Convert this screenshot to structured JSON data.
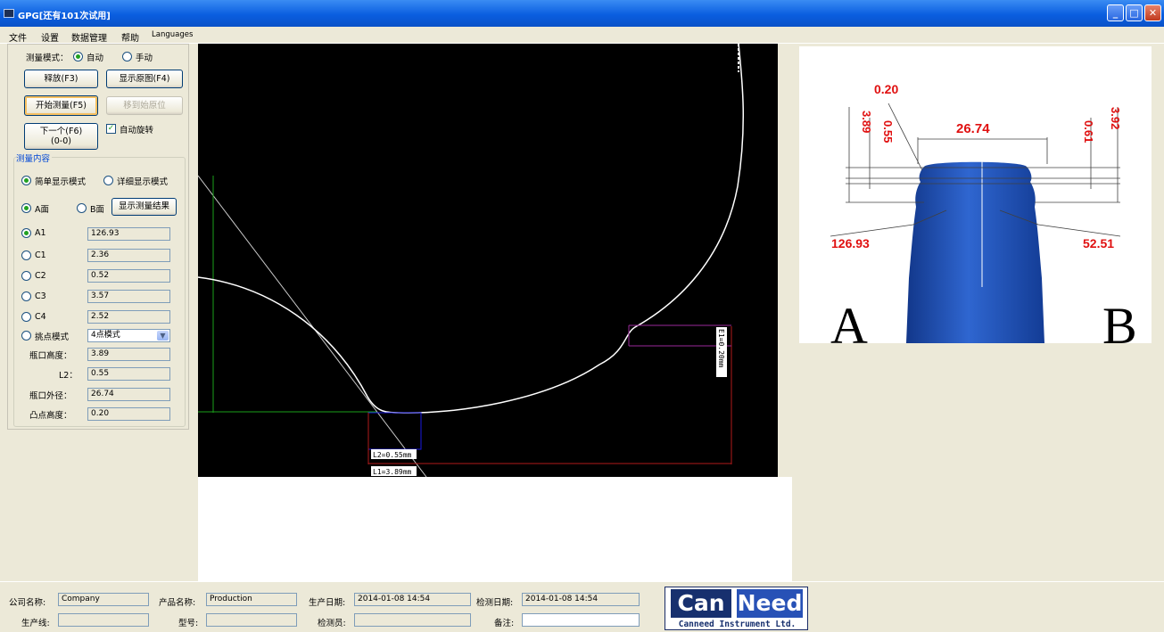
{
  "window": {
    "title": "GPG[还有101次试用]",
    "buttons": {
      "minimize": "_",
      "maximize": "□",
      "close": "✕"
    }
  },
  "menu": [
    "文件",
    "设置",
    "数据管理",
    "帮助",
    "Languages"
  ],
  "controls": {
    "mode_label": "测量模式：",
    "mode_auto": "自动",
    "mode_manual": "手动",
    "mode_selected": "auto",
    "release_button": "释放(F3)",
    "show_original_button": "显示原图(F4)",
    "start_measure_button": "开始测量(F5)",
    "move_to_origin_button": "移到始原位",
    "next_button_line1": "下一个(F6)",
    "next_button_line2": "(0-0)",
    "auto_rotate_label": "自动旋转",
    "auto_rotate_checked": true
  },
  "measure": {
    "group_title": "测量内容",
    "simple_mode": "简单显示模式",
    "detail_mode": "详细显示模式",
    "face_a": "A面",
    "face_b": "B面",
    "show_result_button": "显示测量结果",
    "rows": [
      {
        "label": "A1",
        "value": "126.93",
        "selected": true
      },
      {
        "label": "C1",
        "value": "2.36",
        "selected": false
      },
      {
        "label": "C2",
        "value": "0.52",
        "selected": false
      },
      {
        "label": "C3",
        "value": "3.57",
        "selected": false
      },
      {
        "label": "C4",
        "value": "2.52",
        "selected": false
      }
    ],
    "point_mode_label": "挑点模式",
    "point_mode_value": "4点模式",
    "fields": [
      {
        "label": "瓶口高度：",
        "value": "3.89"
      },
      {
        "label": "L2：",
        "value": "0.55"
      },
      {
        "label": "瓶口外径：",
        "value": "26.74"
      },
      {
        "label": "凸点高度：",
        "value": "0.20"
      }
    ]
  },
  "canvas": {
    "label_l2": "L2=0.55mm",
    "label_l1": "L1=3.89mm",
    "label_e1": "E1=0.20mm"
  },
  "diagram": {
    "top_value": "0.20",
    "left_outer": "3.89",
    "left_inner": "0.55",
    "diameter": "26.74",
    "right_inner": "0.61",
    "right_outer": "3.92",
    "angle_left": "126.93",
    "angle_right": "52.51",
    "side_a": "A",
    "side_b": "B",
    "red_color": "#e01010",
    "bottle_color": "#1d4fb0"
  },
  "footer": {
    "company_label": "公司名称:",
    "company_value": "Company",
    "product_label": "产品名称:",
    "product_value": "Production",
    "prod_date_label": "生产日期:",
    "prod_date_value": "2014-01-08 14:54",
    "check_date_label": "检测日期:",
    "check_date_value": "2014-01-08 14:54",
    "line_label": "生产线:",
    "line_value": "",
    "model_label": "型号:",
    "model_value": "",
    "inspector_label": "检测员:",
    "inspector_value": "",
    "remark_label": "备注:",
    "remark_value": ""
  },
  "logo": {
    "can": "Can",
    "need": "Need",
    "sub": "Canneed Instrument Ltd."
  }
}
